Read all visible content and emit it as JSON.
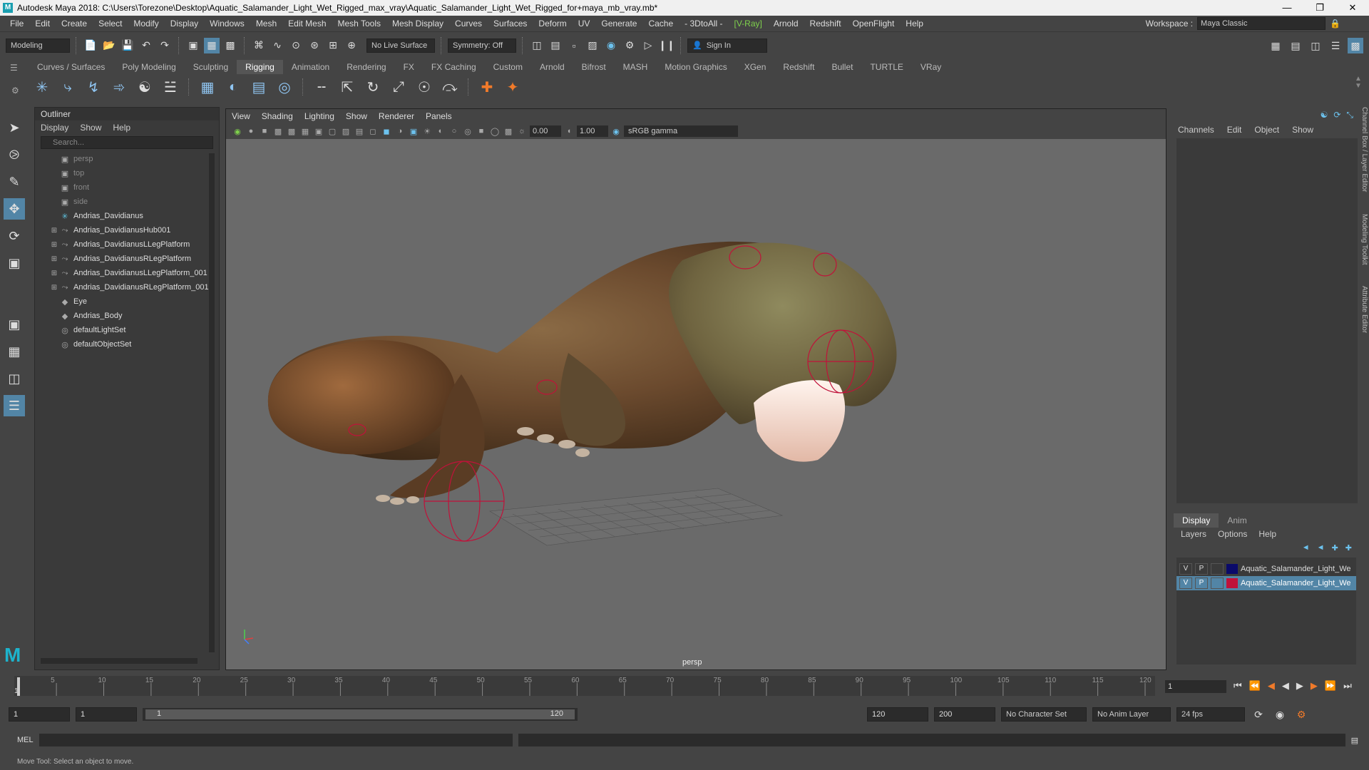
{
  "window": {
    "title": "Autodesk Maya 2018: C:\\Users\\Torezone\\Desktop\\Aquatic_Salamander_Light_Wet_Rigged_max_vray\\Aquatic_Salamander_Light_Wet_Rigged_for+maya_mb_vray.mb*",
    "logo": "M"
  },
  "menubar": {
    "items": [
      "File",
      "Edit",
      "Create",
      "Select",
      "Modify",
      "Display",
      "Windows",
      "Mesh",
      "Edit Mesh",
      "Mesh Tools",
      "Mesh Display",
      "Curves",
      "Surfaces",
      "Deform",
      "UV",
      "Generate",
      "Cache",
      "- 3DtoAll -",
      "[V-Ray]",
      "Arnold",
      "Redshift",
      "OpenFlight",
      "Help"
    ],
    "workspace_label": "Workspace :",
    "workspace_value": "Maya Classic"
  },
  "statusline": {
    "mode": "Modeling",
    "live_surface": "No Live Surface",
    "symmetry": "Symmetry: Off",
    "sign_in": "Sign In"
  },
  "shelf": {
    "tabs": [
      "Curves / Surfaces",
      "Poly Modeling",
      "Sculpting",
      "Rigging",
      "Animation",
      "Rendering",
      "FX",
      "FX Caching",
      "Custom",
      "Arnold",
      "Bifrost",
      "MASH",
      "Motion Graphics",
      "XGen",
      "Redshift",
      "Bullet",
      "TURTLE",
      "VRay"
    ],
    "active_tab": "Rigging"
  },
  "outliner": {
    "title": "Outliner",
    "menu": [
      "Display",
      "Show",
      "Help"
    ],
    "search_placeholder": "Search...",
    "items": [
      {
        "label": "persp",
        "icon": "camera-icon",
        "expandable": false,
        "dim": true
      },
      {
        "label": "top",
        "icon": "camera-icon",
        "expandable": false,
        "dim": true
      },
      {
        "label": "front",
        "icon": "camera-icon",
        "expandable": false,
        "dim": true
      },
      {
        "label": "side",
        "icon": "camera-icon",
        "expandable": false,
        "dim": true
      },
      {
        "label": "Andrias_Davidianus",
        "icon": "joint-icon",
        "expandable": false,
        "dim": false
      },
      {
        "label": "Andrias_DavidianusHub001",
        "icon": "ik-handle-icon",
        "expandable": true,
        "dim": false
      },
      {
        "label": "Andrias_DavidianusLLegPlatform",
        "icon": "ik-handle-icon",
        "expandable": true,
        "dim": false
      },
      {
        "label": "Andrias_DavidianusRLegPlatform",
        "icon": "ik-handle-icon",
        "expandable": true,
        "dim": false
      },
      {
        "label": "Andrias_DavidianusLLegPlatform_001",
        "icon": "ik-handle-icon",
        "expandable": true,
        "dim": false
      },
      {
        "label": "Andrias_DavidianusRLegPlatform_001",
        "icon": "ik-handle-icon",
        "expandable": true,
        "dim": false
      },
      {
        "label": "Eye",
        "icon": "mesh-icon",
        "expandable": false,
        "dim": false
      },
      {
        "label": "Andrias_Body",
        "icon": "mesh-icon",
        "expandable": false,
        "dim": false
      },
      {
        "label": "defaultLightSet",
        "icon": "set-icon",
        "expandable": false,
        "dim": false
      },
      {
        "label": "defaultObjectSet",
        "icon": "set-icon",
        "expandable": false,
        "dim": false
      }
    ]
  },
  "viewport": {
    "menu": [
      "View",
      "Shading",
      "Lighting",
      "Show",
      "Renderer",
      "Panels"
    ],
    "exposure": "0.00",
    "gamma_value": "1.00",
    "color_space": "sRGB gamma",
    "camera": "persp"
  },
  "channelbox": {
    "menu": [
      "Channels",
      "Edit",
      "Object",
      "Show"
    ],
    "side_tabs": [
      "Channel Box / Layer Editor",
      "Modeling Toolkit",
      "Attribute Editor"
    ]
  },
  "layereditor": {
    "tabs": [
      "Display",
      "Anim"
    ],
    "active_tab": "Display",
    "menu": [
      "Layers",
      "Options",
      "Help"
    ],
    "layers": [
      {
        "v": "V",
        "p": "P",
        "name": "Aquatic_Salamander_Light_We",
        "color": "#0a0a6a",
        "selected": false
      },
      {
        "v": "V",
        "p": "P",
        "name": "Aquatic_Salamander_Light_We",
        "color": "#c0123a",
        "selected": true
      }
    ]
  },
  "timeline": {
    "ticks": [
      "5",
      "10",
      "15",
      "20",
      "25",
      "30",
      "35",
      "40",
      "45",
      "50",
      "55",
      "60",
      "65",
      "70",
      "75",
      "80",
      "85",
      "90",
      "95",
      "100",
      "105",
      "110",
      "115",
      "120"
    ],
    "start_label": "1",
    "current_frame": "1"
  },
  "range": {
    "start": "1",
    "playback_start": "1",
    "slider_start": "1",
    "slider_end": "120",
    "playback_end": "120",
    "end": "200",
    "character_set": "No Character Set",
    "anim_layer": "No Anim Layer",
    "fps": "24 fps"
  },
  "mel": {
    "label": "MEL"
  },
  "help_line": "Move Tool: Select an object to move.",
  "colors": {
    "accent": "#5285a6",
    "rig_curve": "#c0123a"
  }
}
